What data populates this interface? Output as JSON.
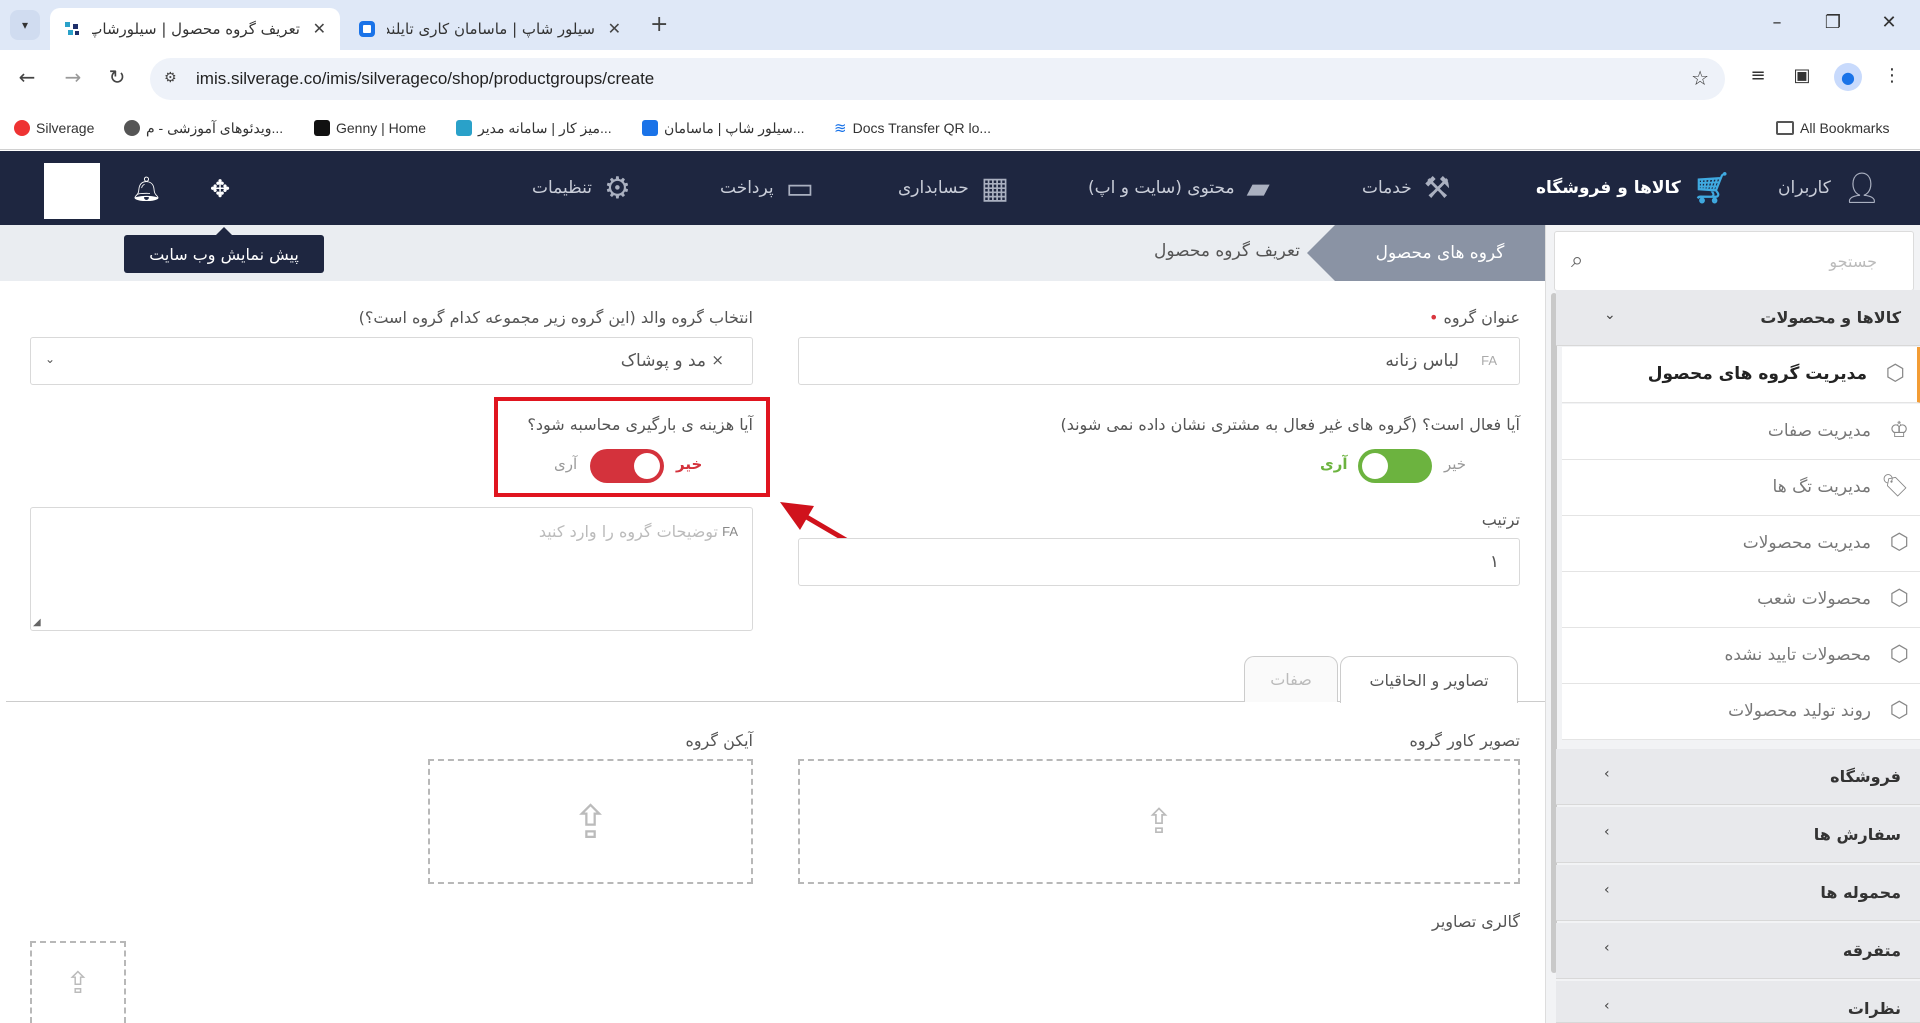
{
  "browser": {
    "tabs": [
      {
        "title": "تعریف گروه محصول | سیلورشاپ",
        "active": true
      },
      {
        "title": "سیلور شاپ | ماسامان کاری تایلند",
        "active": false
      }
    ],
    "new_tab_label": "+",
    "url": "imis.silverage.co/imis/silverageco/shop/productgroups/create",
    "bookmarks": [
      "Silverage",
      "ویدئوهای آموزشی - م...",
      "Genny | Home",
      "میز کار | سامانه مدیر...",
      "سیلور شاپ | ماسامان...",
      "Docs Transfer QR lo...",
      "All Bookmarks"
    ]
  },
  "header": {
    "menu": [
      {
        "label": "کاربران",
        "icon": "users-icon"
      },
      {
        "label": "کالاها و فروشگاه",
        "icon": "cart-icon"
      },
      {
        "label": "خدمات",
        "icon": "broom-icon"
      },
      {
        "label": "محتوی (سایت و اپ)",
        "icon": "folder-icon"
      },
      {
        "label": "حسابداری",
        "icon": "calculator-icon"
      },
      {
        "label": "پرداخت",
        "icon": "credit-card-icon"
      },
      {
        "label": "تنظیمات",
        "icon": "gears-icon"
      }
    ],
    "tooltip": "پیش نمایش وب سایت"
  },
  "breadcrumb": {
    "parent": "گروه های محصول",
    "current": "تعریف گروه محصول"
  },
  "sidebar": {
    "search_placeholder": "جستجو",
    "sections": [
      {
        "label": "کالاها و محصولات",
        "expanded": true
      },
      {
        "label": "فروشگاه"
      },
      {
        "label": "سفارش ها"
      },
      {
        "label": "محموله ها"
      },
      {
        "label": "متفرقه"
      },
      {
        "label": "نظرات"
      }
    ],
    "items": [
      {
        "label": "مدیریت گروه های محصول",
        "active": true
      },
      {
        "label": "مدیریت صفات"
      },
      {
        "label": "مدیریت تگ ها"
      },
      {
        "label": "مدیریت محصولات"
      },
      {
        "label": "محصولات شعب"
      },
      {
        "label": "محصولات تایید نشده"
      },
      {
        "label": "روند تولید محصولات"
      }
    ]
  },
  "form": {
    "group_title_label": "عنوان گروه",
    "group_title_value": "لباس زنانه",
    "lang_tag": "FA",
    "parent_label": "انتخاب گروه والد (این گروه زیر مجموعه کدام گروه است؟)",
    "parent_value": "مد و پوشاک",
    "parent_clear": "×",
    "active_label": "آیا فعال است؟ (گروه های غیر فعال به مشتری نشان داده نمی شوند)",
    "active_yes": "آری",
    "active_no": "خیر",
    "active_state": "yes",
    "loading_cost_label": "آیا هزینه ی بارگیری محاسبه شود؟",
    "loading_yes": "آری",
    "loading_no": "خیر",
    "loading_state": "no",
    "order_label": "ترتیب",
    "order_value": "۱",
    "description_placeholder": "توضیحات گروه را وارد کنید",
    "tabs": [
      {
        "label": "تصاویر و الحاقیات",
        "active": true
      },
      {
        "label": "صفات",
        "active": false
      }
    ],
    "cover_label": "تصویر کاور گروه",
    "icon_label": "آیکن گروه",
    "gallery_label": "گالری تصاویر"
  },
  "colors": {
    "header_bg": "#1e2640",
    "toggle_on": "#6cb33f",
    "toggle_off": "#d4323c",
    "highlight": "#e0151f",
    "active_item_border": "#f39c34"
  }
}
